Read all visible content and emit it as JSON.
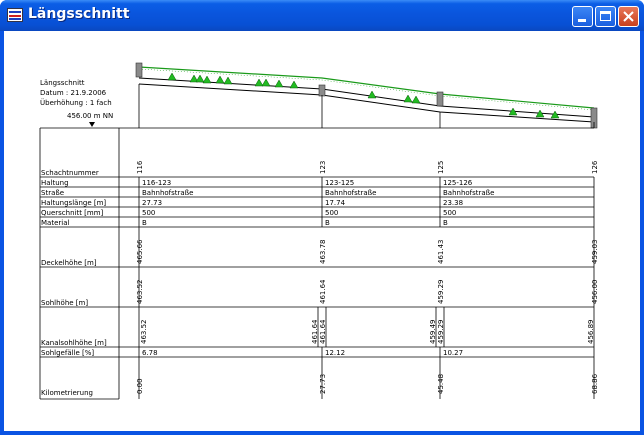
{
  "window": {
    "title": "Längsschnitt"
  },
  "header": {
    "line1": "Längsschnitt",
    "line2": "Datum : 21.9.2006",
    "line3": "Überhöhung : 1 fach",
    "reference": "456.00 m NN"
  },
  "row_labels": {
    "schachtnummer": "Schachtnummer",
    "haltung": "Haltung",
    "strasse": "Straße",
    "haltungslaenge": "Haltungslänge [m]",
    "querschnitt": "Querschnitt [mm]",
    "material": "Material",
    "deckelhoehe": "Deckelhöhe [m]",
    "sohlhoehe": "Sohlhöhe [m]",
    "kanalsohlhoehe": "Kanalsohlhöhe [m]",
    "sohlgefaelle": "Sohlgefälle [%]",
    "kilometrierung": "Kilometrierung"
  },
  "manholes": [
    "116",
    "123",
    "125",
    "126"
  ],
  "segments": [
    {
      "haltung": "116-123",
      "strasse": "Bahnhofstraße",
      "laenge": "27.73",
      "querschnitt": "500",
      "material": "B",
      "gefaelle": "6.78"
    },
    {
      "haltung": "123-125",
      "strasse": "Bahnhofstraße",
      "laenge": "17.74",
      "querschnitt": "500",
      "material": "B",
      "gefaelle": "12.12"
    },
    {
      "haltung": "125-126",
      "strasse": "Bahnhofstraße",
      "laenge": "23.38",
      "querschnitt": "500",
      "material": "B",
      "gefaelle": "10.27"
    }
  ],
  "deckelhoehe": [
    "465.66",
    "463.78",
    "461.43",
    "459.03"
  ],
  "sohlhoehe": [
    "463.52",
    "461.64",
    "459.29",
    "456.00"
  ],
  "kanalsohlhoehe": [
    "463.52",
    "461.64",
    "461.64",
    "459.49",
    "459.29",
    "456.89"
  ],
  "kilometrierung": [
    "0.00",
    "27.73",
    "45.48",
    "68.86"
  ]
}
